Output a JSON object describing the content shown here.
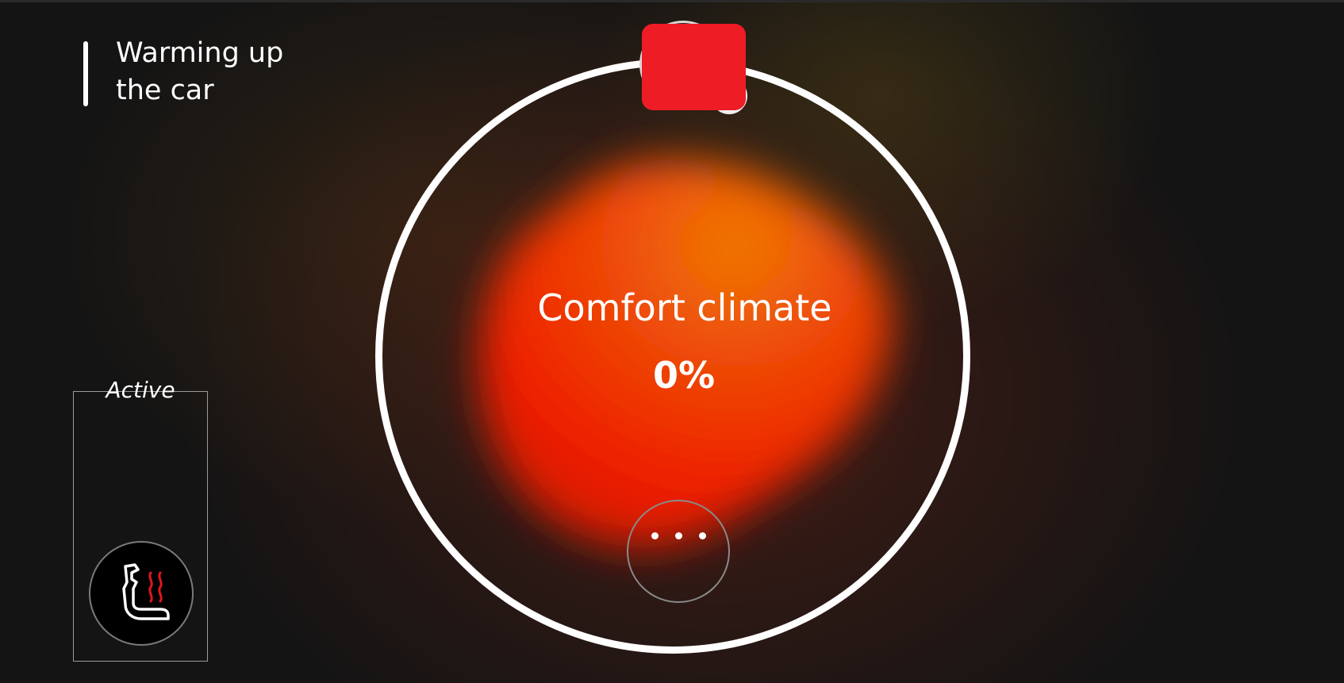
{
  "header": {
    "title_line1": "Warming up",
    "title_line2": "the car"
  },
  "climate": {
    "label": "Comfort climate",
    "value": "0%"
  },
  "stop_button": {
    "color": "#ee1c25"
  },
  "more_button": {
    "icon": "more-dots-icon"
  },
  "seat_panel": {
    "label": "Active",
    "icon": "heated-seat-icon",
    "heat_color": "#e0161d"
  },
  "colors": {
    "ring": "#ffffff",
    "text": "#ffffff",
    "background": "#141414"
  }
}
